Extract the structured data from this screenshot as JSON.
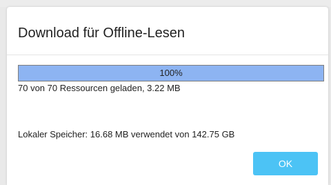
{
  "dialog": {
    "title": "Download für Offline-Lesen",
    "progress": {
      "percent": 100,
      "label": "100%",
      "fill_color": "#8db4f2"
    },
    "status_text": "70 von 70 Ressourcen geladen, 3.22 MB",
    "storage_text": "Lokaler Speicher: 16.68 MB verwendet von 142.75 GB",
    "ok_label": "OK",
    "accent_color": "#4cc3f5"
  }
}
